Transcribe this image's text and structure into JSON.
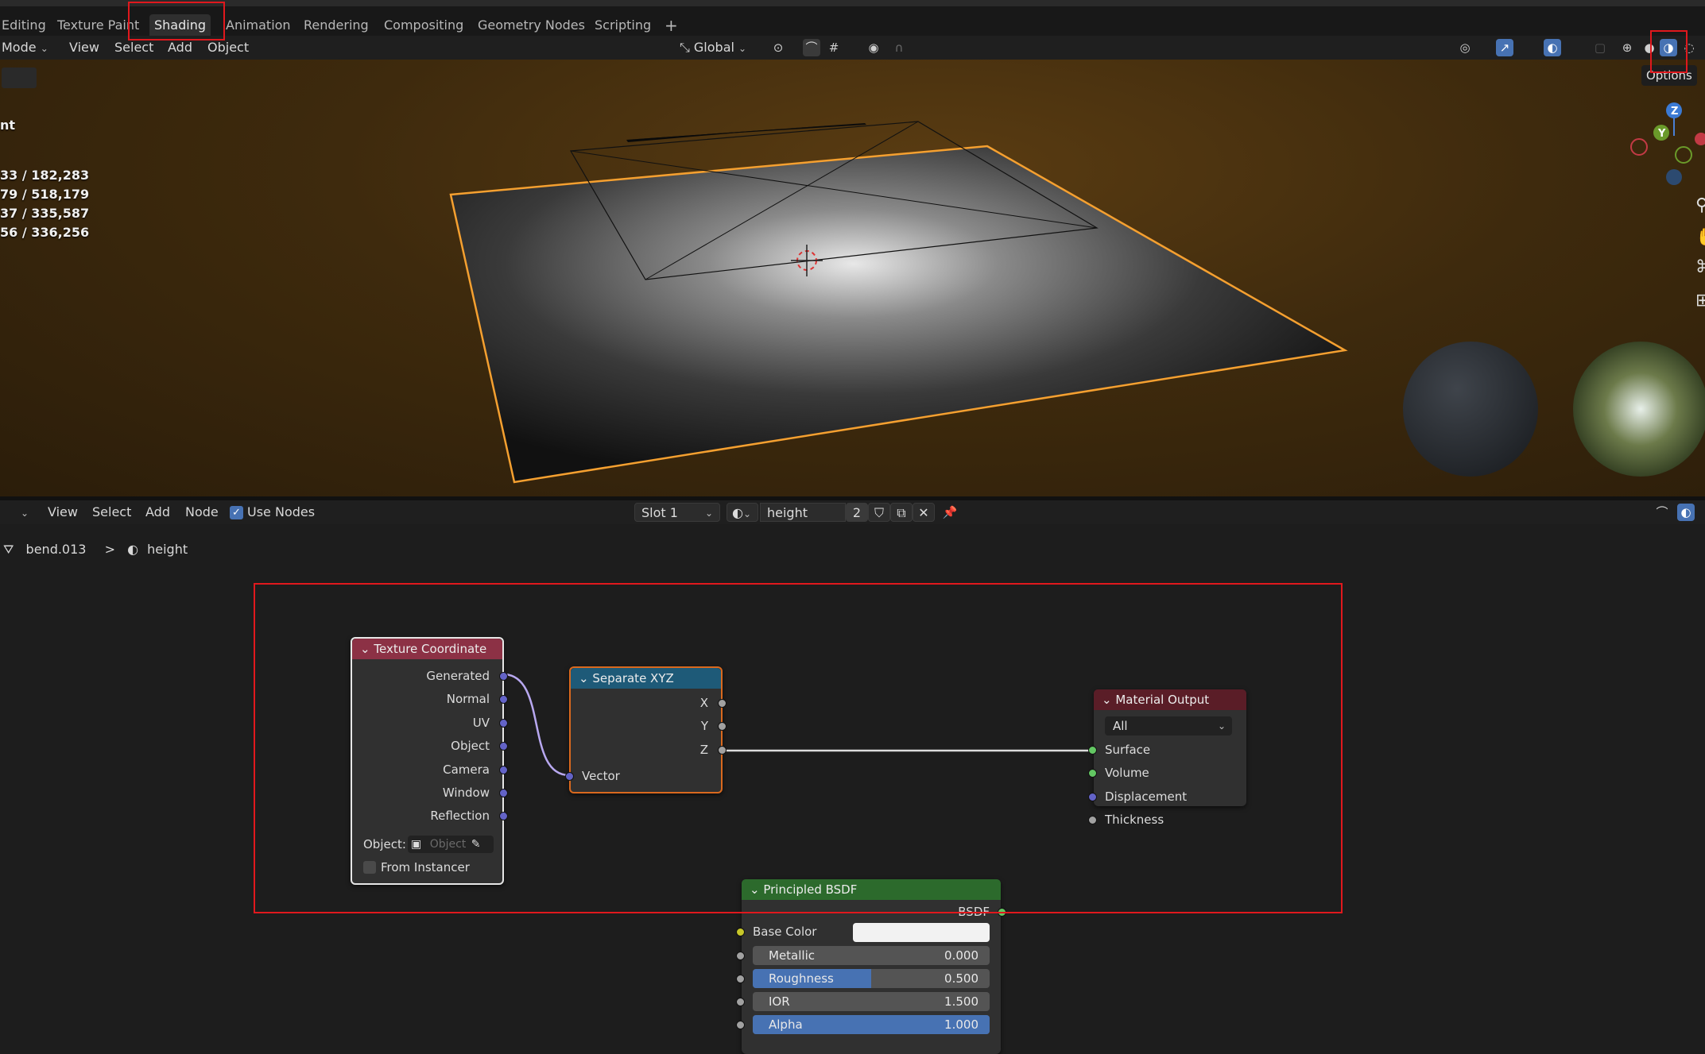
{
  "workspace_tabs": [
    "Editing",
    "Texture Paint",
    "Shading",
    "Animation",
    "Rendering",
    "Compositing",
    "Geometry Nodes",
    "Scripting"
  ],
  "add_workspace": "+",
  "viewport_header": {
    "mode": "Mode",
    "menus": [
      "View",
      "Select",
      "Add",
      "Object"
    ],
    "transform_orientation": "Global",
    "options_label": "Options"
  },
  "viewport_stats": {
    "partial_label": "nt",
    "lines": [
      "33 / 182,283",
      "79 / 518,179",
      "37 / 335,587",
      "56 / 336,256"
    ]
  },
  "gizmo_axes": [
    "Z",
    "Y"
  ],
  "node_header": {
    "menus": [
      "View",
      "Select",
      "Add",
      "Node"
    ],
    "use_nodes_label": "Use Nodes",
    "use_nodes_checked": true,
    "slot": "Slot 1",
    "material_name": "height",
    "user_count": "2"
  },
  "breadcrumb": {
    "object": "bend.013",
    "separator": ">",
    "material": "height"
  },
  "nodes": {
    "texture_coordinate": {
      "title": "Texture Coordinate",
      "outputs": [
        "Generated",
        "Normal",
        "UV",
        "Object",
        "Camera",
        "Window",
        "Reflection"
      ],
      "object_label": "Object:",
      "object_placeholder": "Object",
      "from_instancer": "From Instancer"
    },
    "separate_xyz": {
      "title": "Separate XYZ",
      "outputs": [
        "X",
        "Y",
        "Z"
      ],
      "input": "Vector"
    },
    "material_output": {
      "title": "Material Output",
      "target": "All",
      "inputs": [
        "Surface",
        "Volume",
        "Displacement",
        "Thickness"
      ]
    },
    "principled_bsdf": {
      "title": "Principled BSDF",
      "output": "BSDF",
      "base_color_label": "Base Color",
      "base_color": "#f2f2f2",
      "sliders": [
        {
          "label": "Metallic",
          "value": "0.000",
          "fraction": 0.0
        },
        {
          "label": "Roughness",
          "value": "0.500",
          "fraction": 0.5
        },
        {
          "label": "IOR",
          "value": "1.500",
          "fraction": 0.0
        },
        {
          "label": "Alpha",
          "value": "1.000",
          "fraction": 1.0
        }
      ]
    }
  },
  "colors": {
    "accent_blue": "#4772b3",
    "selection_orange": "#f5a030",
    "annotation_red": "#e0181d",
    "texture_node_header": "#8c3145",
    "separate_node_header": "#1e5a78",
    "output_node_header": "#5a1d27",
    "shader_node_header": "#2c6a2c"
  }
}
